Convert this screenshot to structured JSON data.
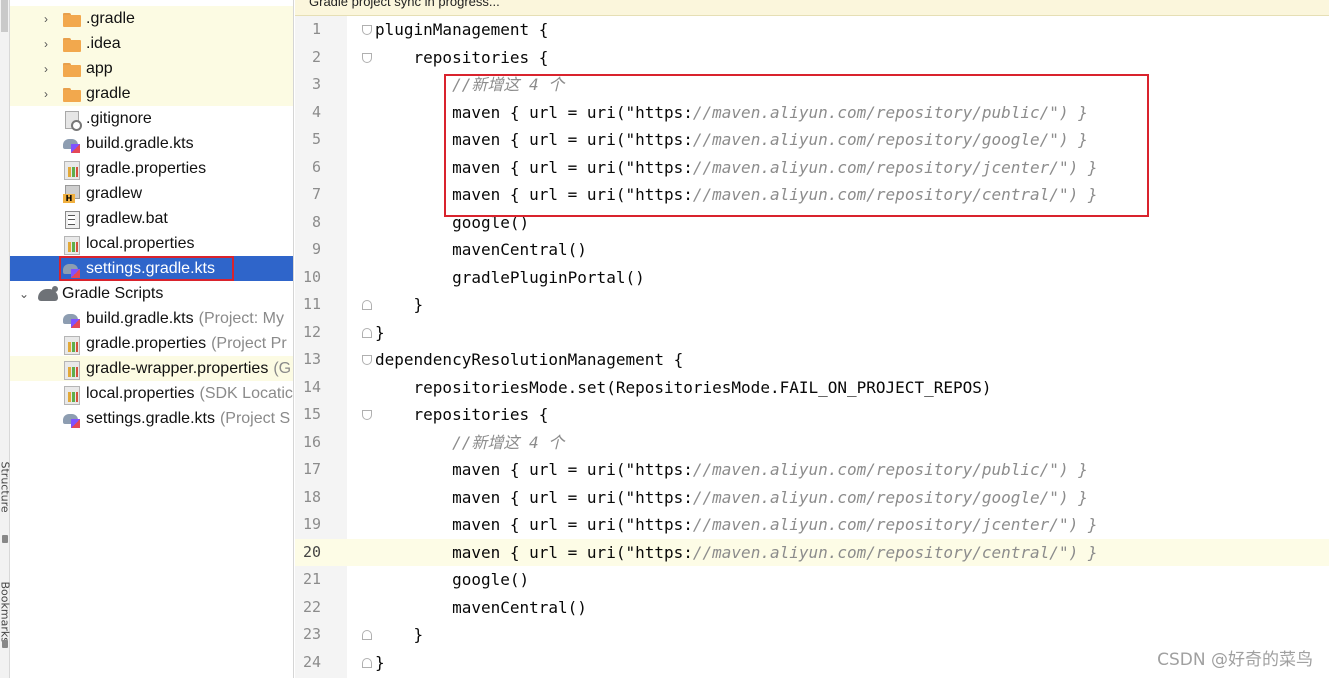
{
  "tool_strip": {
    "structure_label": "Structure",
    "bookmarks_label": "Bookmarks"
  },
  "tree": {
    "items": [
      {
        "label": ".gradle",
        "hint": "",
        "icon": "folder-icon",
        "arrow": "›"
      },
      {
        "label": ".idea",
        "hint": "",
        "icon": "folder-icon",
        "arrow": "›"
      },
      {
        "label": "app",
        "hint": "",
        "icon": "folder-icon",
        "arrow": "›"
      },
      {
        "label": "gradle",
        "hint": "",
        "icon": "folder-icon",
        "arrow": "›"
      },
      {
        "label": ".gitignore",
        "hint": "",
        "icon": "gitignore-file-icon",
        "arrow": ""
      },
      {
        "label": "build.gradle.kts",
        "hint": "",
        "icon": "kotlin-gradle-file-icon",
        "arrow": ""
      },
      {
        "label": "gradle.properties",
        "hint": "",
        "icon": "properties-file-icon",
        "arrow": ""
      },
      {
        "label": "gradlew",
        "hint": "",
        "icon": "gradlew-script-icon",
        "arrow": ""
      },
      {
        "label": "gradlew.bat",
        "hint": "",
        "icon": "batch-file-icon",
        "arrow": ""
      },
      {
        "label": "local.properties",
        "hint": "",
        "icon": "properties-file-icon",
        "arrow": ""
      },
      {
        "label": "settings.gradle.kts",
        "hint": "",
        "icon": "kotlin-gradle-file-icon",
        "arrow": ""
      },
      {
        "label": "Gradle Scripts",
        "hint": "",
        "icon": "gradle-scripts-icon",
        "arrow": "⌄"
      },
      {
        "label": "build.gradle.kts",
        "hint": "(Project: My",
        "icon": "kotlin-gradle-file-icon",
        "arrow": ""
      },
      {
        "label": "gradle.properties",
        "hint": "(Project Pr",
        "icon": "properties-file-icon",
        "arrow": ""
      },
      {
        "label": "gradle-wrapper.properties",
        "hint": "(G",
        "icon": "properties-file-icon",
        "arrow": ""
      },
      {
        "label": "local.properties",
        "hint": "(SDK Locatic",
        "icon": "properties-file-icon",
        "arrow": ""
      },
      {
        "label": "settings.gradle.kts",
        "hint": "(Project S",
        "icon": "kotlin-gradle-file-icon",
        "arrow": ""
      }
    ]
  },
  "editor": {
    "notification": "Gradle project sync in progress...",
    "current_line": 20,
    "lines": [
      {
        "num": "1",
        "text": "pluginManagement {"
      },
      {
        "num": "2",
        "text": "    repositories {"
      },
      {
        "num": "3",
        "text": "        //新增这 4 个"
      },
      {
        "num": "4",
        "text": "        maven { url = uri(\"https://maven.aliyun.com/repository/public/\") }"
      },
      {
        "num": "5",
        "text": "        maven { url = uri(\"https://maven.aliyun.com/repository/google/\") }"
      },
      {
        "num": "6",
        "text": "        maven { url = uri(\"https://maven.aliyun.com/repository/jcenter/\") }"
      },
      {
        "num": "7",
        "text": "        maven { url = uri(\"https://maven.aliyun.com/repository/central/\") }"
      },
      {
        "num": "8",
        "text": "        google()"
      },
      {
        "num": "9",
        "text": "        mavenCentral()"
      },
      {
        "num": "10",
        "text": "        gradlePluginPortal()"
      },
      {
        "num": "11",
        "text": "    }"
      },
      {
        "num": "12",
        "text": "}"
      },
      {
        "num": "13",
        "text": "dependencyResolutionManagement {"
      },
      {
        "num": "14",
        "text": "    repositoriesMode.set(RepositoriesMode.FAIL_ON_PROJECT_REPOS)"
      },
      {
        "num": "15",
        "text": "    repositories {"
      },
      {
        "num": "16",
        "text": "        //新增这 4 个"
      },
      {
        "num": "17",
        "text": "        maven { url = uri(\"https://maven.aliyun.com/repository/public/\") }"
      },
      {
        "num": "18",
        "text": "        maven { url = uri(\"https://maven.aliyun.com/repository/google/\") }"
      },
      {
        "num": "19",
        "text": "        maven { url = uri(\"https://maven.aliyun.com/repository/jcenter/\") }"
      },
      {
        "num": "20",
        "text": "        maven { url = uri(\"https://maven.aliyun.com/repository/central/\") }"
      },
      {
        "num": "21",
        "text": "        google()"
      },
      {
        "num": "22",
        "text": "        mavenCentral()"
      },
      {
        "num": "23",
        "text": "    }"
      },
      {
        "num": "24",
        "text": "}"
      }
    ]
  },
  "watermark": "CSDN @好奇的菜鸟"
}
